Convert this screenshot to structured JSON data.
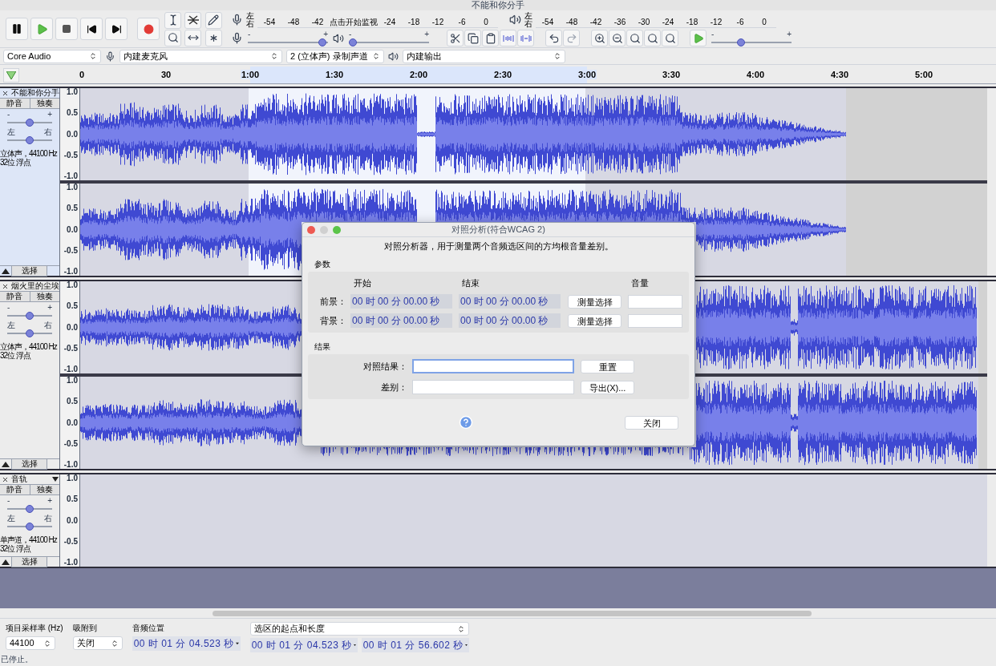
{
  "window": {
    "title": "不能和你分手"
  },
  "record_meter": {
    "channels": [
      "左",
      "右"
    ],
    "ticks": [
      {
        "kind": "tick",
        "label": "-54"
      },
      {
        "kind": "tick",
        "label": "-48"
      },
      {
        "kind": "tick",
        "label": "-42"
      },
      {
        "kind": "hint",
        "label": "点击开始监视"
      },
      {
        "kind": "tick",
        "label": "-24"
      },
      {
        "kind": "tick",
        "label": "-18"
      },
      {
        "kind": "tick",
        "label": "-12"
      },
      {
        "kind": "tick",
        "label": "-6"
      },
      {
        "kind": "tick",
        "label": "0"
      }
    ]
  },
  "playback_meter": {
    "channels": [
      "左",
      "右"
    ],
    "ticks": [
      {
        "kind": "tick",
        "label": "-54"
      },
      {
        "kind": "tick",
        "label": "-48"
      },
      {
        "kind": "tick",
        "label": "-42"
      },
      {
        "kind": "tick",
        "label": "-36"
      },
      {
        "kind": "tick",
        "label": "-30"
      },
      {
        "kind": "tick",
        "label": "-24"
      },
      {
        "kind": "tick",
        "label": "-18"
      },
      {
        "kind": "tick",
        "label": "-12"
      },
      {
        "kind": "tick",
        "label": "-6"
      },
      {
        "kind": "tick",
        "label": "0"
      }
    ]
  },
  "record_volume": {
    "labels": [
      "-",
      "+"
    ],
    "level": 0.98
  },
  "playback_volume": {
    "labels": [
      "-",
      "+"
    ],
    "level": 0.0
  },
  "play_speed": {
    "labels": [
      "-",
      "+"
    ],
    "level": 0.35
  },
  "devices": {
    "host": "Core Audio",
    "input": "内建麦克风",
    "channels": "2 (立体声) 录制声道",
    "output": "内建输出"
  },
  "ruler": [
    {
      "label": "0",
      "in_selection": false
    },
    {
      "label": "30",
      "in_selection": false
    },
    {
      "label": "1:00",
      "in_selection": true
    },
    {
      "label": "1:30",
      "in_selection": true
    },
    {
      "label": "2:00",
      "in_selection": true
    },
    {
      "label": "2:30",
      "in_selection": true
    },
    {
      "label": "3:00",
      "in_selection": true
    },
    {
      "label": "3:30",
      "in_selection": false
    },
    {
      "label": "4:00",
      "in_selection": false
    },
    {
      "label": "4:30",
      "in_selection": false
    },
    {
      "label": "5:00",
      "in_selection": false
    }
  ],
  "tracks": [
    {
      "name": "不能和你分手",
      "selected": true,
      "mute": "静音",
      "solo": "独奏",
      "gain": {
        "labels": [
          "-",
          "+"
        ],
        "level": 0.5
      },
      "pan": {
        "labels": [
          "左",
          "右"
        ],
        "level": 0.5
      },
      "info": [
        "立体声，44100 Hz",
        "32位 浮点"
      ],
      "select": "选择",
      "channels": [
        {
          "axis": [
            "1.0",
            "0.5",
            "0.0",
            "-0.5",
            "-1.0"
          ]
        },
        {
          "axis": [
            "1.0",
            "0.5",
            "0.0",
            "-0.5",
            "-1.0"
          ]
        }
      ]
    },
    {
      "name": "烟火里的尘埃",
      "selected": false,
      "mute": "静音",
      "solo": "独奏",
      "gain": {
        "labels": [
          "-",
          "+"
        ],
        "level": 0.5
      },
      "pan": {
        "labels": [
          "左",
          "右"
        ],
        "level": 0.5
      },
      "info": [
        "立体声，44100 Hz",
        "32位 浮点"
      ],
      "select": "选择",
      "channels": [
        {
          "axis": [
            "1.0",
            "0.5",
            "0.0",
            "-0.5",
            "-1.0"
          ]
        },
        {
          "axis": [
            "1.0",
            "0.5",
            "0.0",
            "-0.5",
            "-1.0"
          ]
        }
      ]
    },
    {
      "name": "音轨",
      "selected": false,
      "mute": "静音",
      "solo": "独奏",
      "gain": {
        "labels": [
          "-",
          "+"
        ],
        "level": 0.5
      },
      "pan": {
        "labels": [
          "左",
          "右"
        ],
        "level": 0.5
      },
      "info": [
        "单声道，44100 Hz",
        "32位 浮点"
      ],
      "select": "选择",
      "channels": [
        {
          "axis": [
            "1.0",
            "0.5",
            "0.0",
            "-0.5",
            "-1.0"
          ]
        }
      ]
    }
  ],
  "dialog": {
    "title": "对照分析(符合WCAG 2)",
    "description": "对照分析器，用于测量两个音频选区间的方均根音量差别。",
    "parameters": {
      "heading": "参数",
      "columns": [
        "开始",
        "结束",
        "音量"
      ],
      "rows": [
        {
          "label": "前景：",
          "start": "00 时 00 分 00.00 秒",
          "end": "00 时 00 分 00.00 秒",
          "button": "测量选择"
        },
        {
          "label": "背景：",
          "start": "00 时 00 分 00.00 秒",
          "end": "00 时 00 分 00.00 秒",
          "button": "测量选择"
        }
      ]
    },
    "results": {
      "heading": "结果",
      "rows": [
        {
          "label": "对照结果：",
          "button": "重置",
          "focused": true
        },
        {
          "label": "差别：",
          "button": "导出(X)...",
          "focused": false
        }
      ]
    },
    "close": "关闭"
  },
  "bottom": {
    "rate": {
      "label": "项目采样率 (Hz)",
      "value": "44100"
    },
    "snap": {
      "label": "吸附到",
      "value": "关闭"
    },
    "position": {
      "label": "音频位置",
      "value": "00 时 01 分 04.523 秒"
    },
    "selection": {
      "mode": "选区的起点和长度",
      "values": [
        "00 时 01 分 04.523 秒",
        "00 时 01 分 56.602 秒"
      ]
    }
  },
  "status": "已停止。"
}
